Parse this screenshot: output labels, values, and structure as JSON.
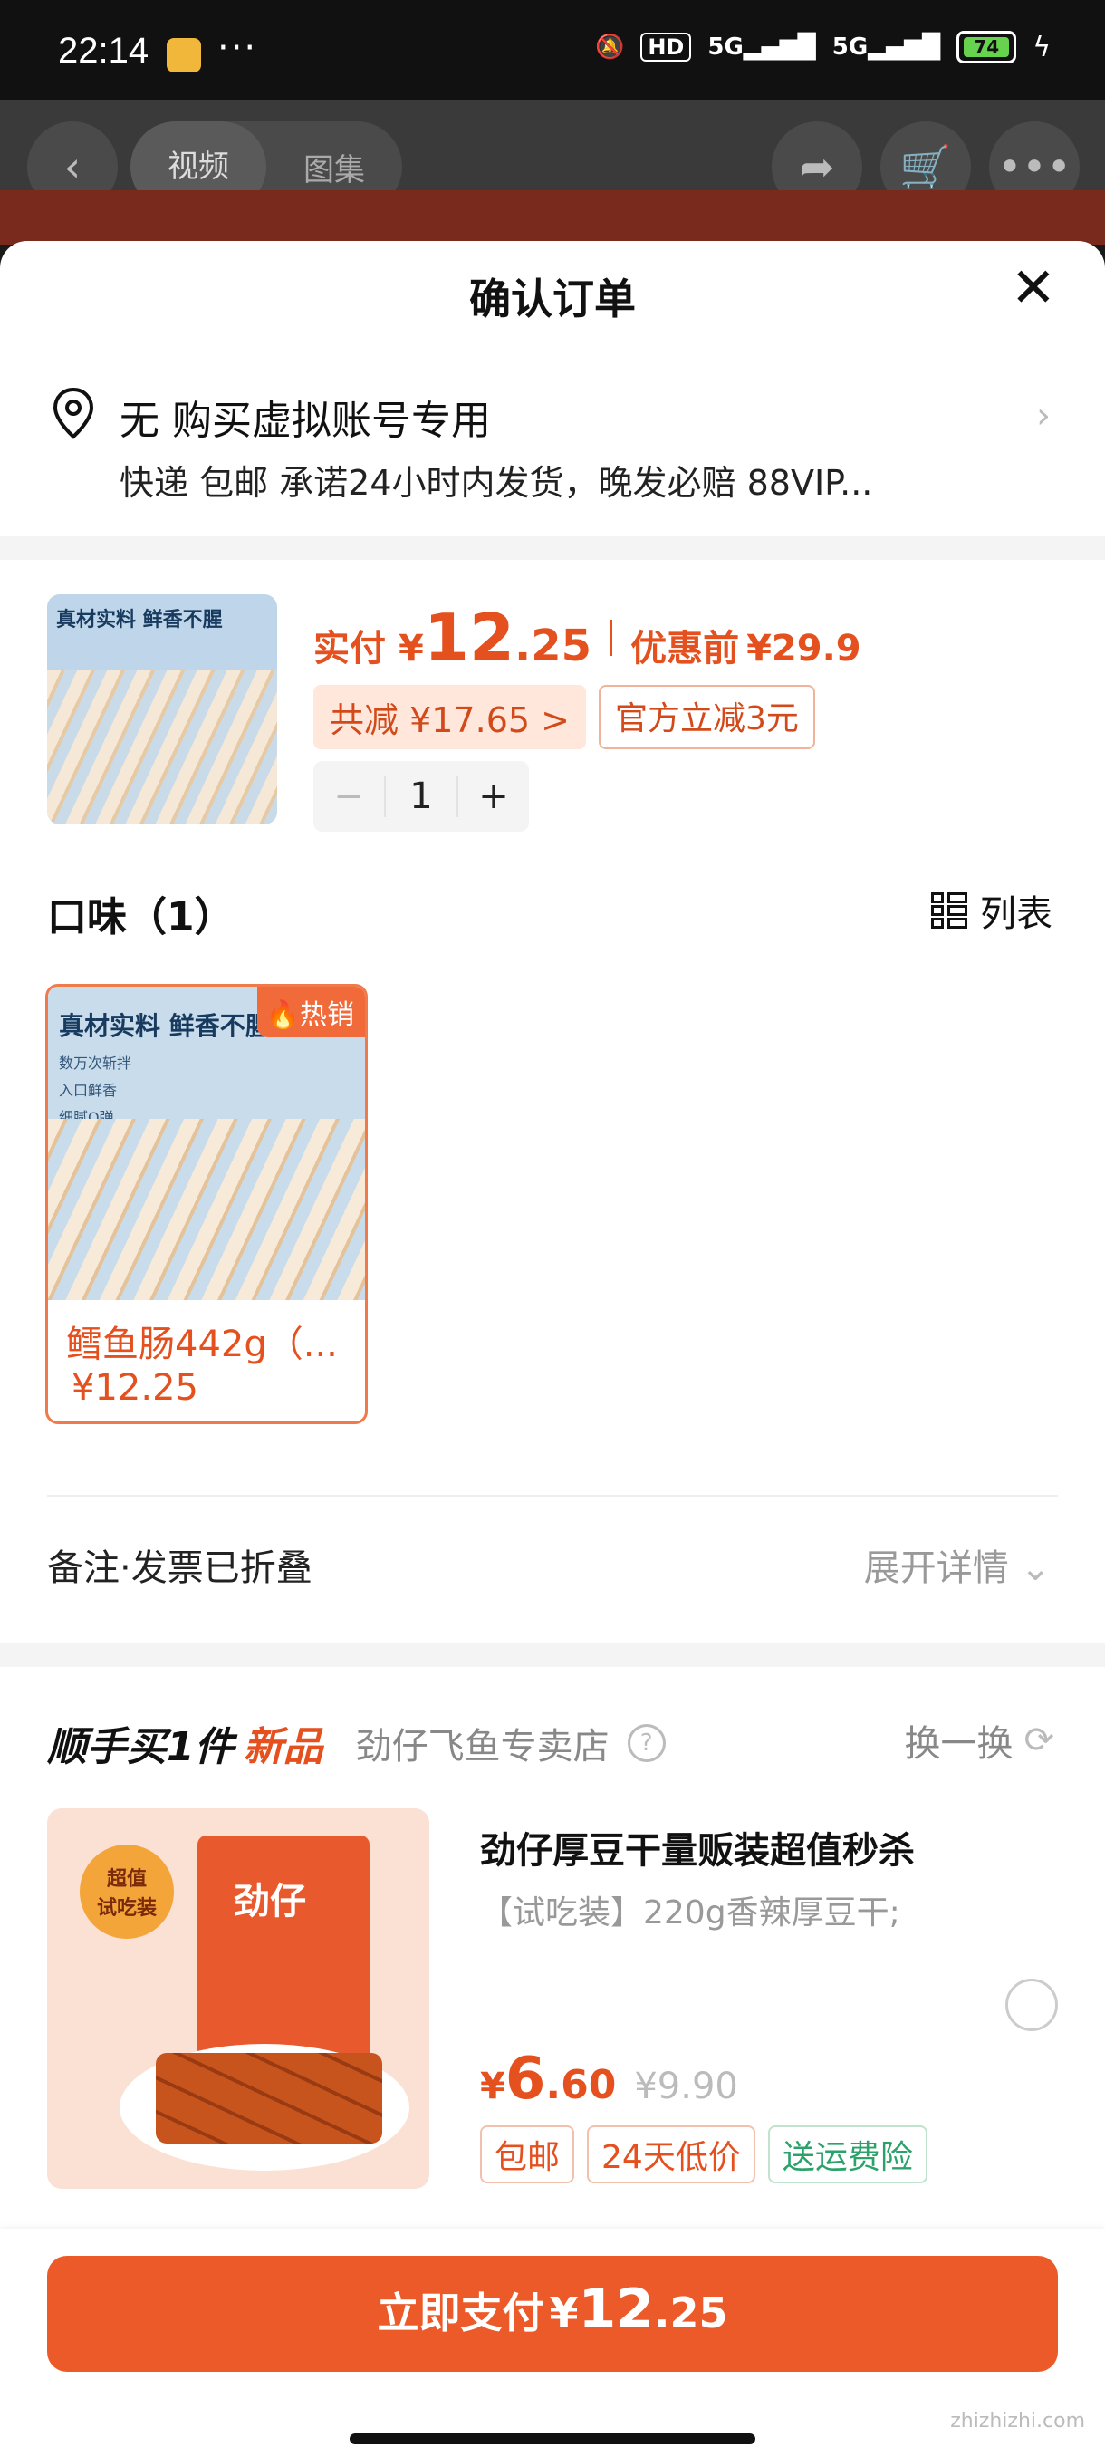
{
  "status": {
    "time": "22:14",
    "dots": "···",
    "hd": "HD",
    "net1": "5G",
    "net2": "5G",
    "battery": "74"
  },
  "bg": {
    "tab_video": "视频",
    "tab_gallery": "图集"
  },
  "sheet": {
    "title": "确认订单"
  },
  "address": {
    "name": "无 购买虚拟账号专用",
    "desc": "快递 包邮 承诺24小时内发货，晚发必赔 88VIP..."
  },
  "product": {
    "pay_label": "实付",
    "yen": "¥",
    "price_int": "12",
    "price_dec": ".25",
    "before_label": "优惠前",
    "before_price": "¥29.9",
    "total_discount": "共减 ¥17.65 >",
    "official_discount": "官方立减3元",
    "thumb_caption": "真材实料 鲜香不腥",
    "qty": "1",
    "minus": "−",
    "plus": "+"
  },
  "flavor": {
    "header": "口味（1）",
    "list_label": "列表",
    "item": {
      "hot": "热销",
      "caption": "真材实料 鲜香不腥",
      "bullets": "数万次斩拌\n入口鲜香\n细腻Q弹",
      "title": "鳕鱼肠442g（...",
      "price": "¥12.25"
    }
  },
  "remark": {
    "label": "备注·发票已折叠",
    "expand": "展开详情"
  },
  "addon": {
    "title_a": "顺手买1件",
    "title_b": "新品",
    "store": "劲仔飞鱼专卖店",
    "qmark": "?",
    "swap": "换一换",
    "item": {
      "name": "劲仔厚豆干量贩装超值秒杀",
      "spec": "【试吃装】220g香辣厚豆干;",
      "yen": "¥",
      "price_int": "6",
      "price_dec": ".60",
      "orig": "¥9.90",
      "tags": [
        "包邮",
        "24天低价",
        "送运费险"
      ],
      "badge_l1": "超值",
      "badge_l2": "试吃装",
      "brand": "劲仔"
    }
  },
  "footer": {
    "pay_label": "立即支付",
    "yen": "¥",
    "int": "12",
    "dec": ".25"
  },
  "watermark": "zhizhizhi.com"
}
